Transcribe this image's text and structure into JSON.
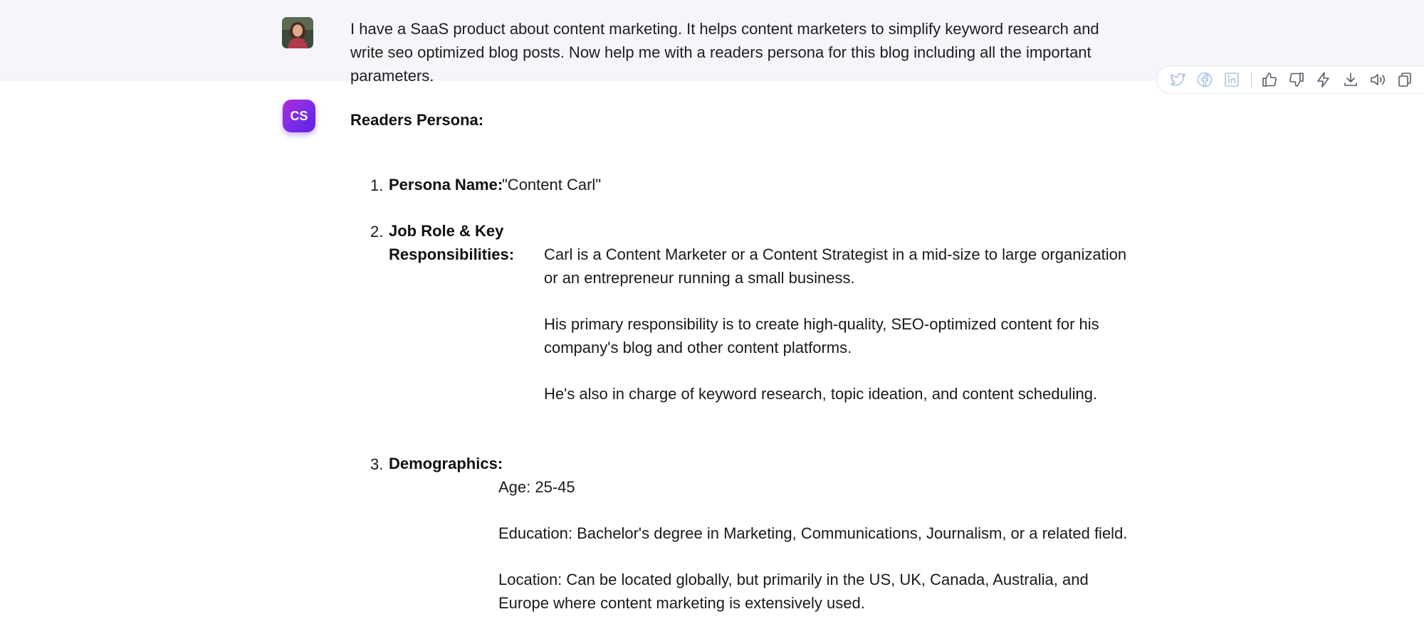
{
  "user_message": {
    "text": "I have a SaaS product about content marketing. It helps content marketers to simplify keyword research and write seo optimized blog posts. Now help me with a readers persona for this blog including all the important parameters."
  },
  "toolbar": {
    "icons": [
      "twitter-icon",
      "facebook-icon",
      "linkedin-icon",
      "thumbs-up-icon",
      "thumbs-down-icon",
      "lightning-icon",
      "download-icon",
      "speaker-icon",
      "copy-icon"
    ]
  },
  "bot_message": {
    "avatar_initials": "CS",
    "title": "Readers Persona:",
    "items": [
      {
        "number": "1.",
        "label": "Persona Name:",
        "value": "\"Content Carl\""
      },
      {
        "number": "2.",
        "label_line1": "Job Role & Key",
        "label_line2": "Responsibilities:",
        "paragraphs": [
          "Carl is a Content Marketer or a Content Strategist in a mid-size to large organization or an entrepreneur running a small business.",
          "His primary responsibility is to create high-quality, SEO-optimized content for his company's blog and other content platforms.",
          "He's also in charge of keyword research, topic ideation, and content scheduling."
        ]
      },
      {
        "number": "3.",
        "label": "Demographics:",
        "paragraphs": [
          "Age: 25-45",
          "Education: Bachelor's degree in Marketing, Communications, Journalism, or a related field.",
          "Location: Can be located globally, but primarily in the US, UK, Canada, Australia, and Europe where content marketing is extensively used."
        ]
      }
    ]
  }
}
